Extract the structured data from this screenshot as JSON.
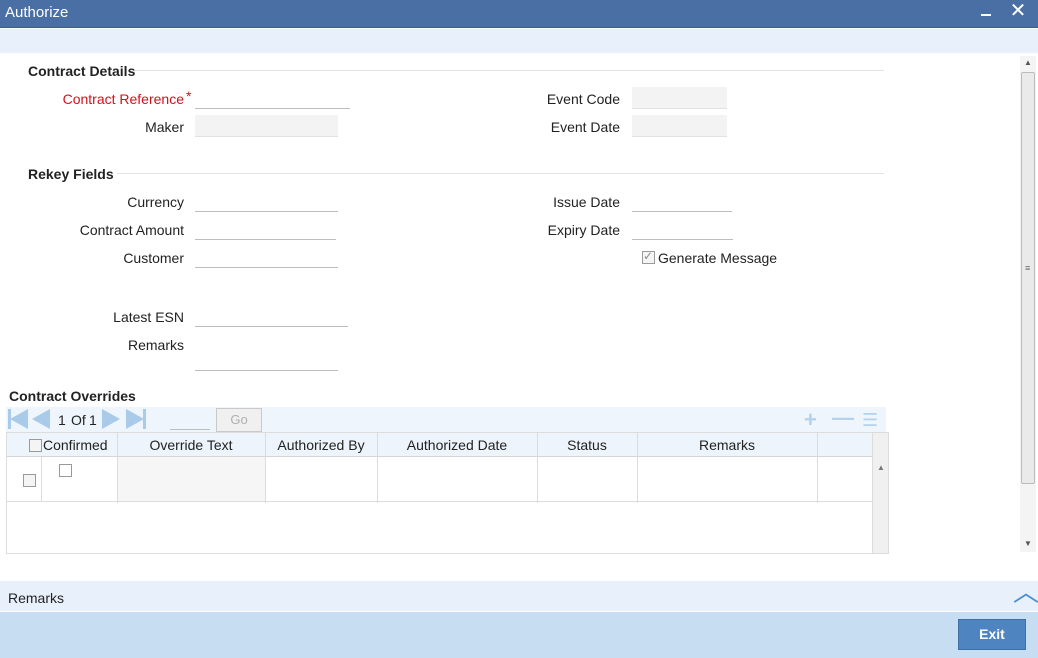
{
  "window": {
    "title": "Authorize",
    "close_glyph": "✕"
  },
  "contract_details": {
    "section_title": "Contract Details",
    "contract_reference": {
      "label": "Contract Reference",
      "required_mark": "*",
      "value": ""
    },
    "maker": {
      "label": "Maker",
      "value": ""
    },
    "event_code": {
      "label": "Event Code",
      "value": ""
    },
    "event_date": {
      "label": "Event Date",
      "value": ""
    }
  },
  "rekey_fields": {
    "section_title": "Rekey Fields",
    "currency": {
      "label": "Currency",
      "value": ""
    },
    "contract_amount": {
      "label": "Contract Amount",
      "value": ""
    },
    "customer": {
      "label": "Customer",
      "value": ""
    },
    "issue_date": {
      "label": "Issue Date",
      "value": ""
    },
    "expiry_date": {
      "label": "Expiry Date",
      "value": ""
    },
    "generate_message": {
      "label": "Generate Message",
      "checked": true
    },
    "latest_esn": {
      "label": "Latest ESN",
      "value": ""
    },
    "remarks": {
      "label": "Remarks",
      "value": ""
    }
  },
  "contract_overrides": {
    "section_title": "Contract Overrides",
    "pagination": {
      "current": "1",
      "of_label": "Of",
      "total": "1",
      "go_label": "Go"
    },
    "columns": [
      "Confirmed",
      "Override Text",
      "Authorized By",
      "Authorized Date",
      "Status",
      "Remarks"
    ],
    "rows": [
      {
        "confirmed": false,
        "override_text": "",
        "authorized_by": "",
        "authorized_date": "",
        "status": "",
        "remarks": ""
      }
    ]
  },
  "bottom": {
    "remarks_label": "Remarks",
    "exit_label": "Exit"
  },
  "colors": {
    "titlebar": "#4a6fa5",
    "required": "#d0121e",
    "exit_button": "#4e84bf",
    "footer": "#c7ddf1"
  }
}
